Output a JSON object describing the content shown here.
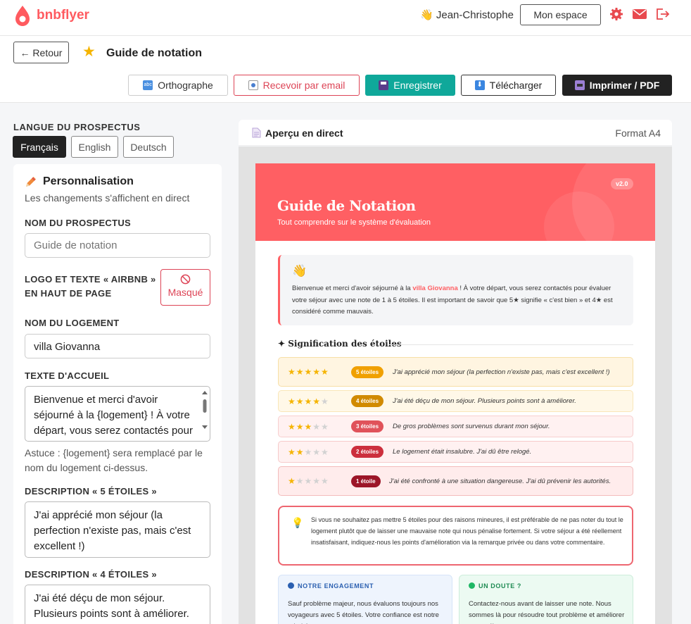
{
  "app": {
    "name": "bnbflyer"
  },
  "topbar": {
    "user_emoji": "👋",
    "user_name": "Jean-Christophe",
    "espace_label": "Mon espace"
  },
  "subbar": {
    "back_label": "← Retour",
    "title": "Guide de notation"
  },
  "toolbar": {
    "spell_icon": "abc",
    "spell_label": "Orthographe",
    "email_label": "Recevoir par email",
    "save_label": "Enregistrer",
    "download_label": "Télécharger",
    "print_label": "Imprimer / PDF"
  },
  "language": {
    "label": "LANGUE DU PROSPECTUS",
    "options": [
      "Français",
      "English",
      "Deutsch"
    ],
    "selected": "Français"
  },
  "panel": {
    "title": "Personnalisation",
    "hint": "Les changements s'affichent en direct",
    "name_label": "NOM DU PROSPECTUS",
    "name_placeholder": "Guide de notation",
    "logo_label": "LOGO ET TEXTE « AIRBNB » EN HAUT DE PAGE",
    "logo_state": "Masqué",
    "lodging_label": "NOM DU LOGEMENT",
    "lodging_value": "villa Giovanna",
    "welcome_label": "TEXTE D'ACCUEIL",
    "welcome_value": "Bienvenue et merci d'avoir séjourné à la {logement} ! À votre départ, vous serez contactés pour",
    "tip": "Astuce : {logement} sera remplacé par le nom du logement ci-dessus.",
    "desc5_label": "DESCRIPTION « 5 ÉTOILES »",
    "desc5_value": "J'ai apprécié mon séjour (la perfection n'existe pas, mais c'est excellent !)",
    "desc4_label": "DESCRIPTION « 4 ÉTOILES »",
    "desc4_value": "J'ai été déçu de mon séjour. Plusieurs points sont à améliorer."
  },
  "preview": {
    "title": "Aperçu en direct",
    "format": "Format A4",
    "version": "v2.0",
    "heading": "Guide de Notation",
    "subheading": "Tout comprendre sur le système d'évaluation",
    "welcome_emoji": "👋",
    "welcome_pre": "Bienvenue et merci d'avoir séjourné à la ",
    "welcome_lodging": "villa Giovanna",
    "welcome_post": " ! À votre départ, vous serez contactés pour évaluer votre séjour avec une note de 1 à 5 étoiles. Il est important de savoir que 5★ signifie « c'est bien » et 4★ est considéré comme mauvais.",
    "section_title": "✦ Signification des étoiles",
    "ratings": [
      {
        "stars_on": "★★★★★",
        "stars_off": "",
        "badge": "5 étoiles",
        "text": "J'ai apprécié mon séjour (la perfection n'existe pas, mais c'est excellent !)"
      },
      {
        "stars_on": "★★★★",
        "stars_off": "★",
        "badge": "4 étoiles",
        "text": "J'ai été déçu de mon séjour. Plusieurs points sont à améliorer."
      },
      {
        "stars_on": "★★★",
        "stars_off": "★★",
        "badge": "3 étoiles",
        "text": "De gros problèmes sont survenus durant mon séjour."
      },
      {
        "stars_on": "★★",
        "stars_off": "★★★",
        "badge": "2 étoiles",
        "text": "Le logement était insalubre. J'ai dû être relogé."
      },
      {
        "stars_on": "★",
        "stars_off": "★★★★",
        "badge": "1 étoile",
        "text": "J'ai été confronté à une situation dangereuse. J'ai dû prévenir les autorités."
      }
    ],
    "tip_emoji": "💡",
    "tip_text": "Si vous ne souhaitez pas mettre 5 étoiles pour des raisons mineures, il est préférable de ne pas noter du tout le logement plutôt que de laisser une mauvaise note qui nous pénalise fortement. Si votre séjour a été réellement insatisfaisant, indiquez-nous les points d'amélioration via la remarque privée ou dans votre commentaire.",
    "engagement_title": "NOTRE ENGAGEMENT",
    "engagement_text": "Sauf problème majeur, nous évaluons toujours nos voyageurs avec 5 étoiles. Votre confiance est notre priorité.",
    "doubt_title": "UN DOUTE ?",
    "doubt_text": "Contactez-nous avant de laisser une note. Nous sommes là pour résoudre tout problème et améliorer votre séjour."
  },
  "colors": {
    "brand": "#ff5a5f",
    "save": "#0fa89a",
    "dark": "#222222"
  }
}
